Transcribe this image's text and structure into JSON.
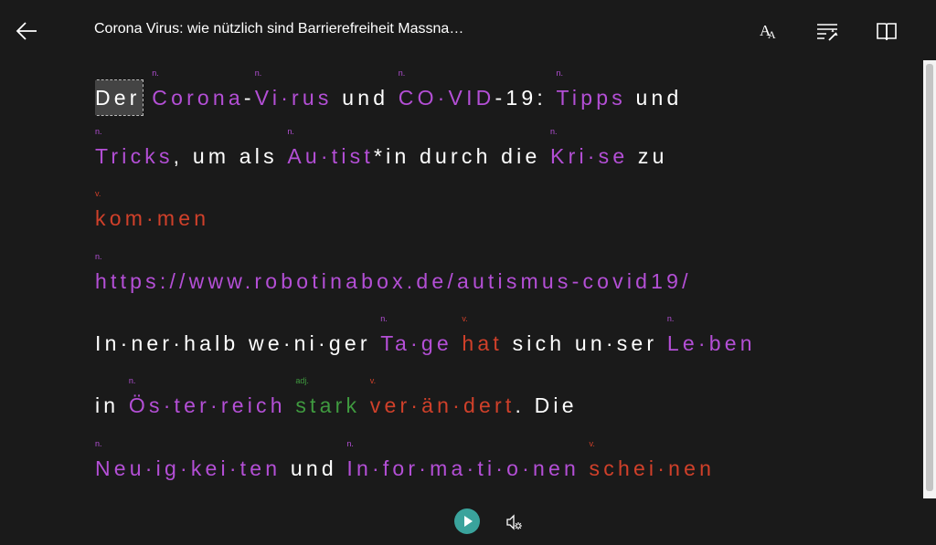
{
  "header": {
    "title": "Corona Virus: wie nützlich sind Barrierefreiheit Massna…",
    "icons": [
      "back-arrow-icon",
      "text-size-icon",
      "grammar-tools-icon",
      "reading-preferences-icon"
    ]
  },
  "reader": {
    "lines": [
      [
        {
          "t": "Der",
          "cls": "focus"
        },
        {
          "t": " "
        },
        {
          "t": "Corona",
          "cls": "noun",
          "tag": "n."
        },
        {
          "t": "-"
        },
        {
          "t": "Vi·rus",
          "cls": "noun",
          "tag": "n."
        },
        {
          "t": " und "
        },
        {
          "t": "CO·VID",
          "cls": "noun",
          "tag": "n."
        },
        {
          "t": "-19: "
        },
        {
          "t": "Tipps",
          "cls": "noun",
          "tag": "n."
        },
        {
          "t": " und"
        }
      ],
      [
        {
          "t": "Tricks",
          "cls": "noun",
          "tag": "n."
        },
        {
          "t": ", um als "
        },
        {
          "t": "Au·tist",
          "cls": "noun",
          "tag": "n."
        },
        {
          "t": "*in durch die "
        },
        {
          "t": "Kri·se",
          "cls": "noun",
          "tag": "n."
        },
        {
          "t": " zu"
        }
      ],
      [
        {
          "t": "kom·men",
          "cls": "verb",
          "tag": "v."
        }
      ],
      [
        {
          "t": "https://www.robotinabox.de/autismus-covid19/",
          "cls": "noun",
          "tag": "n."
        }
      ],
      [
        {
          "t": "In·ner·halb we·ni·ger "
        },
        {
          "t": "Ta·ge",
          "cls": "noun",
          "tag": "n."
        },
        {
          "t": " "
        },
        {
          "t": "hat",
          "cls": "verb",
          "tag": "v."
        },
        {
          "t": " sich un·ser "
        },
        {
          "t": "Le·ben",
          "cls": "noun",
          "tag": "n."
        }
      ],
      [
        {
          "t": "in "
        },
        {
          "t": "Ös·ter·reich",
          "cls": "noun",
          "tag": "n."
        },
        {
          "t": " "
        },
        {
          "t": "stark",
          "cls": "adj",
          "tag": "adj."
        },
        {
          "t": " "
        },
        {
          "t": "ver·än·dert",
          "cls": "verb",
          "tag": "v."
        },
        {
          "t": ". Die"
        }
      ],
      [
        {
          "t": "Neu·ig·kei·ten",
          "cls": "noun",
          "tag": "n."
        },
        {
          "t": " und "
        },
        {
          "t": "In·for·ma·ti·o·nen",
          "cls": "noun",
          "tag": "n."
        },
        {
          "t": " "
        },
        {
          "t": "schei·nen",
          "cls": "verb",
          "tag": "v."
        }
      ]
    ]
  },
  "bottom": {
    "play_icon": "play-icon",
    "voice_icon": "voice-settings-icon"
  }
}
